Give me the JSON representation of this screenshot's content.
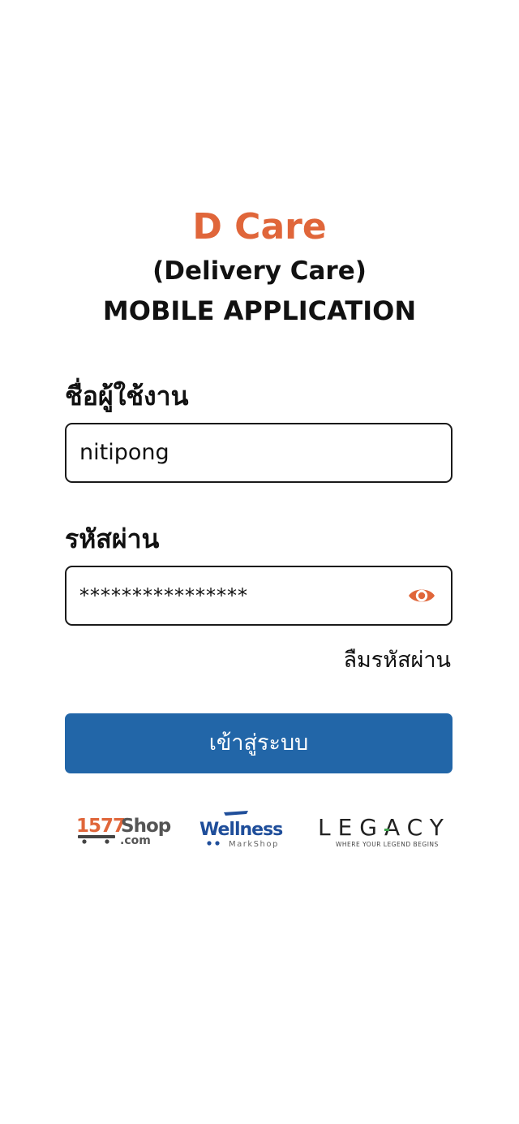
{
  "header": {
    "app_name": "D Care",
    "app_subtitle": "(Delivery Care)",
    "app_tagline": "MOBILE APPLICATION"
  },
  "form": {
    "username_label": "ชื่อผู้ใช้งาน",
    "username_value": "nitipong",
    "password_label": "รหัสผ่าน",
    "password_value": "****************",
    "password_toggle_icon": "eye-icon",
    "forgot_password": "ลืมรหัสผ่าน",
    "login_button": "เข้าสู่ระบบ"
  },
  "partners": {
    "shop1577": {
      "text_main": "1577",
      "text_shop": "Shop",
      "text_com": ".com"
    },
    "wellness": {
      "text_main": "Wellness",
      "text_sub": "MarkShop"
    },
    "legacy": {
      "text_main": "LEGACY",
      "text_sub": "WHERE YOUR LEGEND BEGINS"
    }
  },
  "colors": {
    "accent_orange": "#E0663A",
    "button_blue": "#2266A8",
    "wellness_blue": "#1F4E9A"
  }
}
